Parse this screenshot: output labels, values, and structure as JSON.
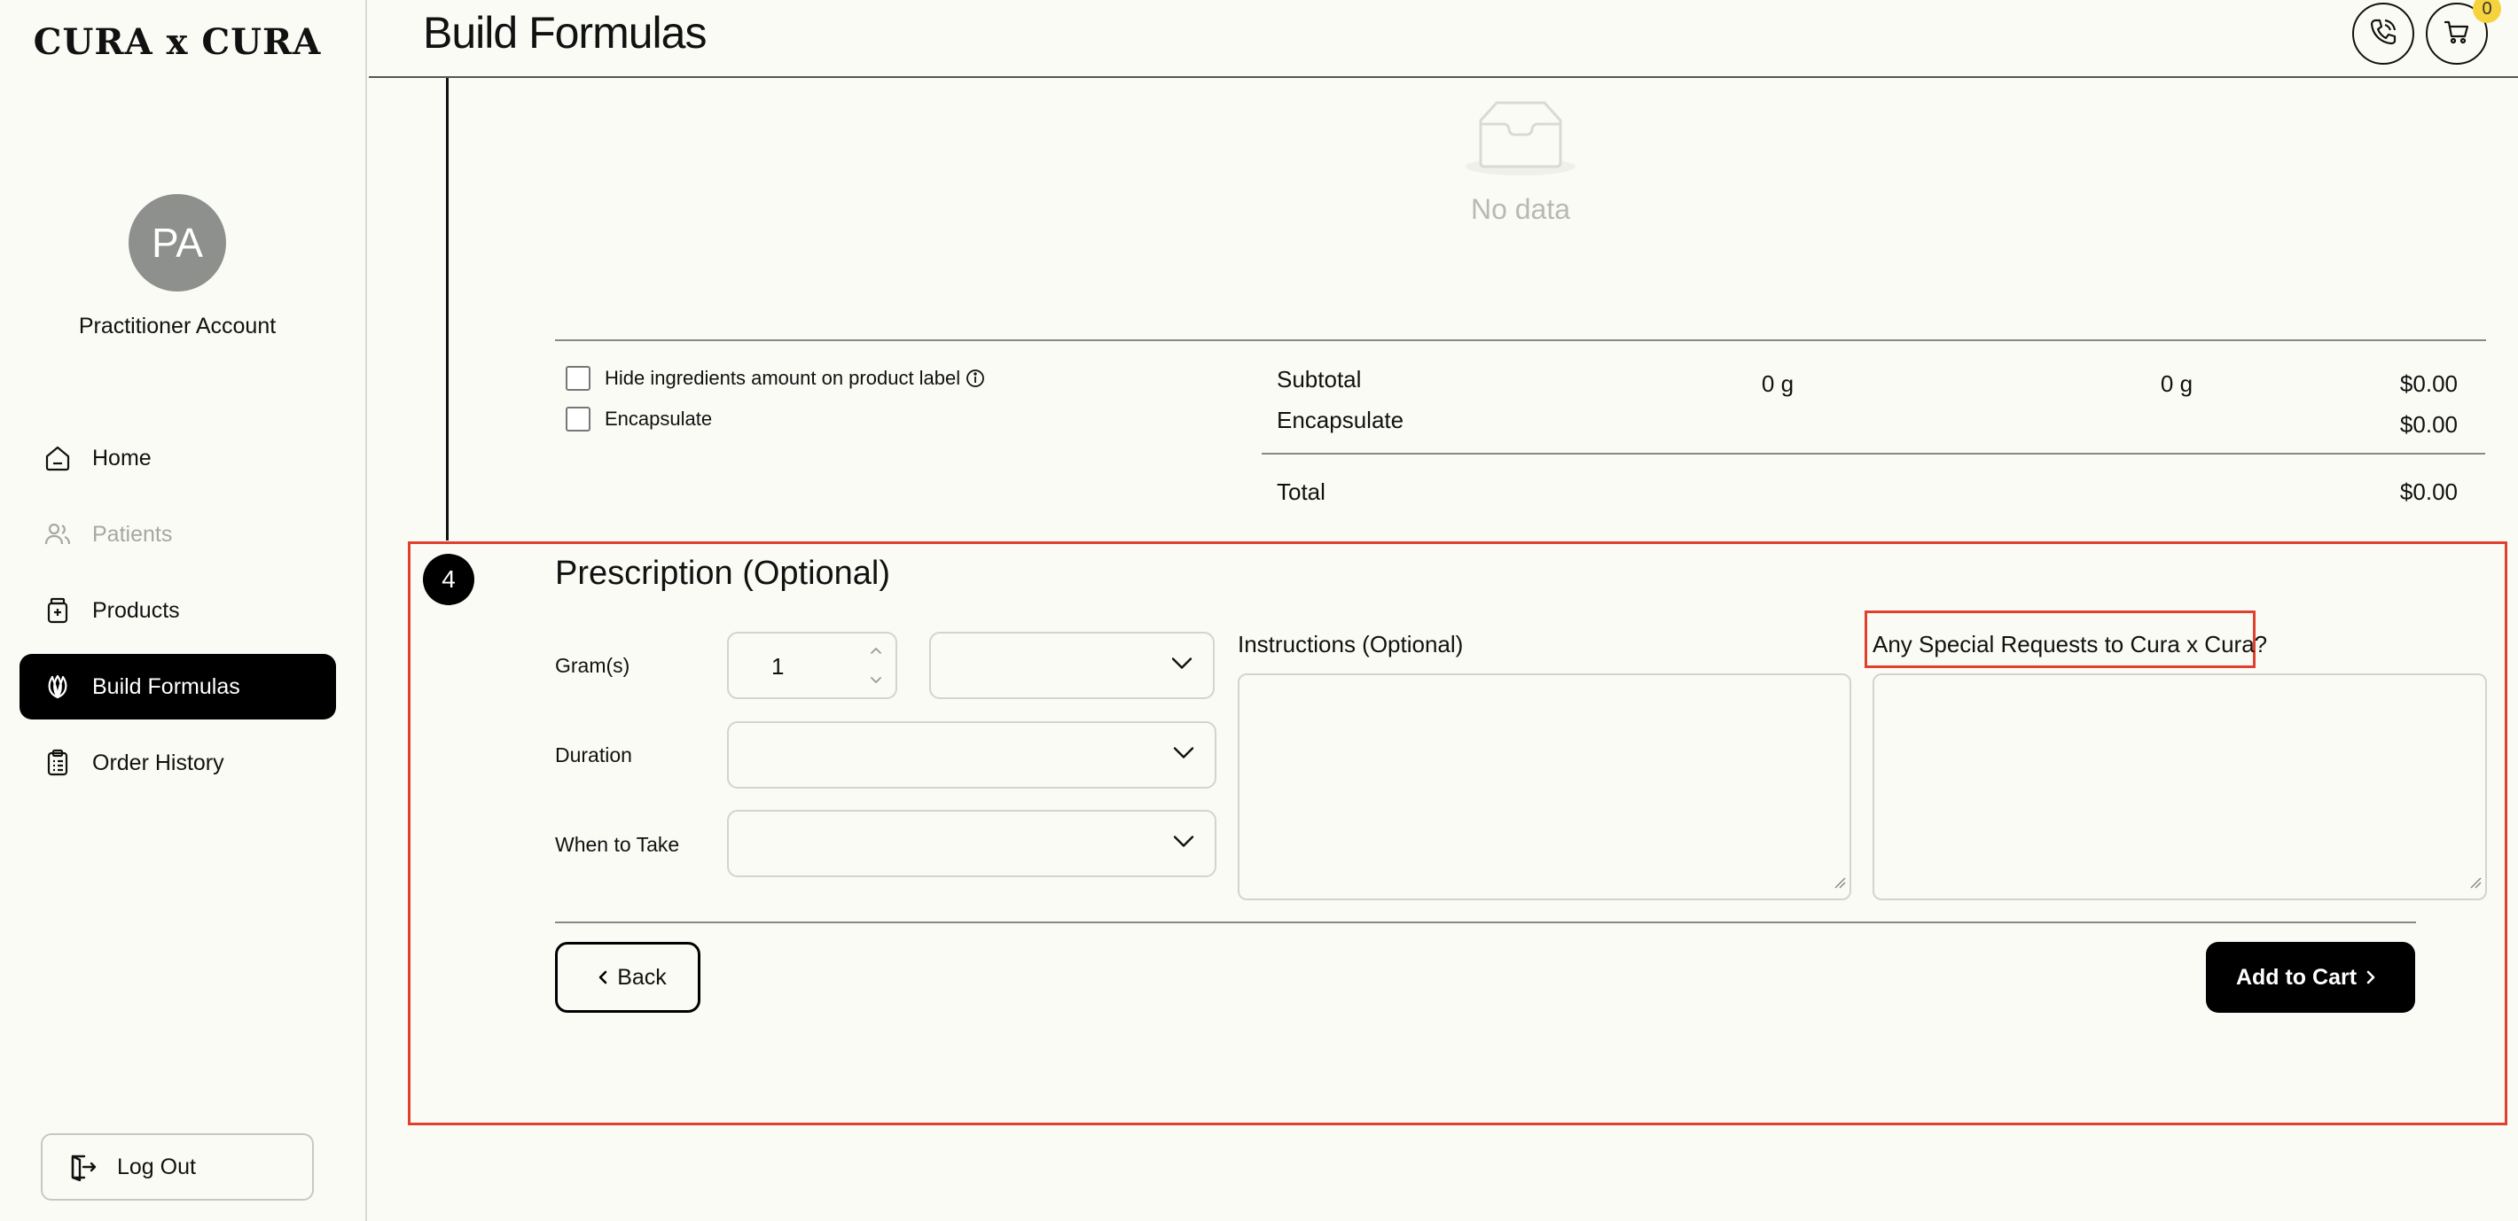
{
  "sidebar": {
    "logo": "CURA x CURA",
    "avatar_initials": "PA",
    "account_name": "Practitioner Account",
    "items": [
      {
        "label": "Home",
        "icon": "home-icon",
        "state": "normal"
      },
      {
        "label": "Patients",
        "icon": "users-icon",
        "state": "disabled"
      },
      {
        "label": "Products",
        "icon": "bottle-icon",
        "state": "normal"
      },
      {
        "label": "Build Formulas",
        "icon": "leaf-icon",
        "state": "active"
      },
      {
        "label": "Order History",
        "icon": "clipboard-icon",
        "state": "normal"
      }
    ],
    "logout_label": "Log Out"
  },
  "header": {
    "title": "Build Formulas",
    "cart_count": "0"
  },
  "ingredients": {
    "empty_text": "No data",
    "hide_amount_label": "Hide ingredients amount on product label",
    "encapsulate_label": "Encapsulate"
  },
  "summary": {
    "subtotal_label": "Subtotal",
    "subtotal_grams_1": "0 g",
    "subtotal_grams_2": "0 g",
    "subtotal_price": "$0.00",
    "encapsulate_label": "Encapsulate",
    "encapsulate_price": "$0.00",
    "total_label": "Total",
    "total_price": "$0.00"
  },
  "prescription": {
    "step_number": "4",
    "title": "Prescription (Optional)",
    "grams_label": "Gram(s)",
    "grams_value": "1",
    "unit_value": "",
    "duration_label": "Duration",
    "duration_value": "",
    "when_label": "When to Take",
    "when_value": "",
    "instructions_label": "Instructions (Optional)",
    "special_label": "Any Special Requests to Cura x Cura?",
    "back_label": "Back",
    "add_to_cart_label": "Add to Cart"
  },
  "colors": {
    "accent": "#000000",
    "highlight": "#e0402d",
    "badge": "#f6d23c",
    "background": "#fbfbf6"
  }
}
